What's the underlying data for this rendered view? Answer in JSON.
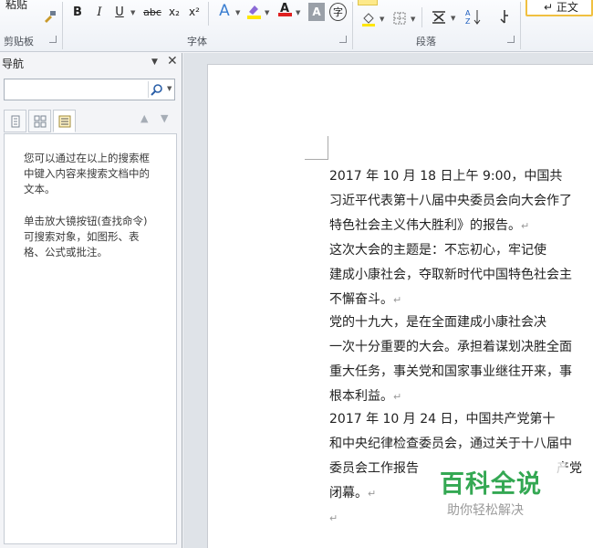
{
  "ribbon": {
    "clipboard": {
      "paste_label": "粘贴",
      "group_label": "剪贴板"
    },
    "font": {
      "group_label": "字体",
      "bold": "B",
      "italic": "I",
      "underline": "U",
      "strikethrough": "abc",
      "subscript": "x₂",
      "superscript": "x²",
      "text_effects": "A",
      "font_color": "A",
      "char_shading": "A",
      "enclose_char": "字"
    },
    "paragraph": {
      "group_label": "段落"
    },
    "styles": {
      "normal_style": "↵ 正文"
    }
  },
  "nav": {
    "title": "导航",
    "search_placeholder": "",
    "hint1": [
      "您可以通过在以上的搜索框",
      "中键入内容来搜索文档中的",
      "文本。"
    ],
    "hint2": [
      "单击放大镜按钮(查找命令)",
      "可搜索对象，如图形、表",
      "格、公式或批注。"
    ]
  },
  "document": {
    "paragraphs": [
      [
        "    2017 年 10 月 18 日上午 9:00，中国共",
        "习近平代表第十八届中央委员会向大会作了",
        "特色社会主义伟大胜利》的报告。"
      ],
      [
        "    这次大会的主题是：不忘初心，牢记使",
        "建成小康社会，夺取新时代中国特色社会主",
        "不懈奋斗。"
      ],
      [
        "    党的十九大，是在全面建成小康社会决",
        "一次十分重要的大会。承担着谋划决胜全面",
        "重大任务，事关党和国家事业继往开来，事",
        "根本利益。"
      ],
      [
        "    2017 年 10 月 24 日，中国共产党第十",
        "和中央纪律检查委员会，通过关于十八届中",
        "委员会工作报告",
        "闭幕。"
      ]
    ],
    "para4_line3_tail": "产党",
    "para_mark": "↵"
  },
  "watermark": {
    "title": "百科全说",
    "subtitle": "助你轻松解决"
  },
  "colors": {
    "accent_green": "#34a853",
    "highlight_yellow": "#ffe600",
    "font_red": "#e02020"
  }
}
